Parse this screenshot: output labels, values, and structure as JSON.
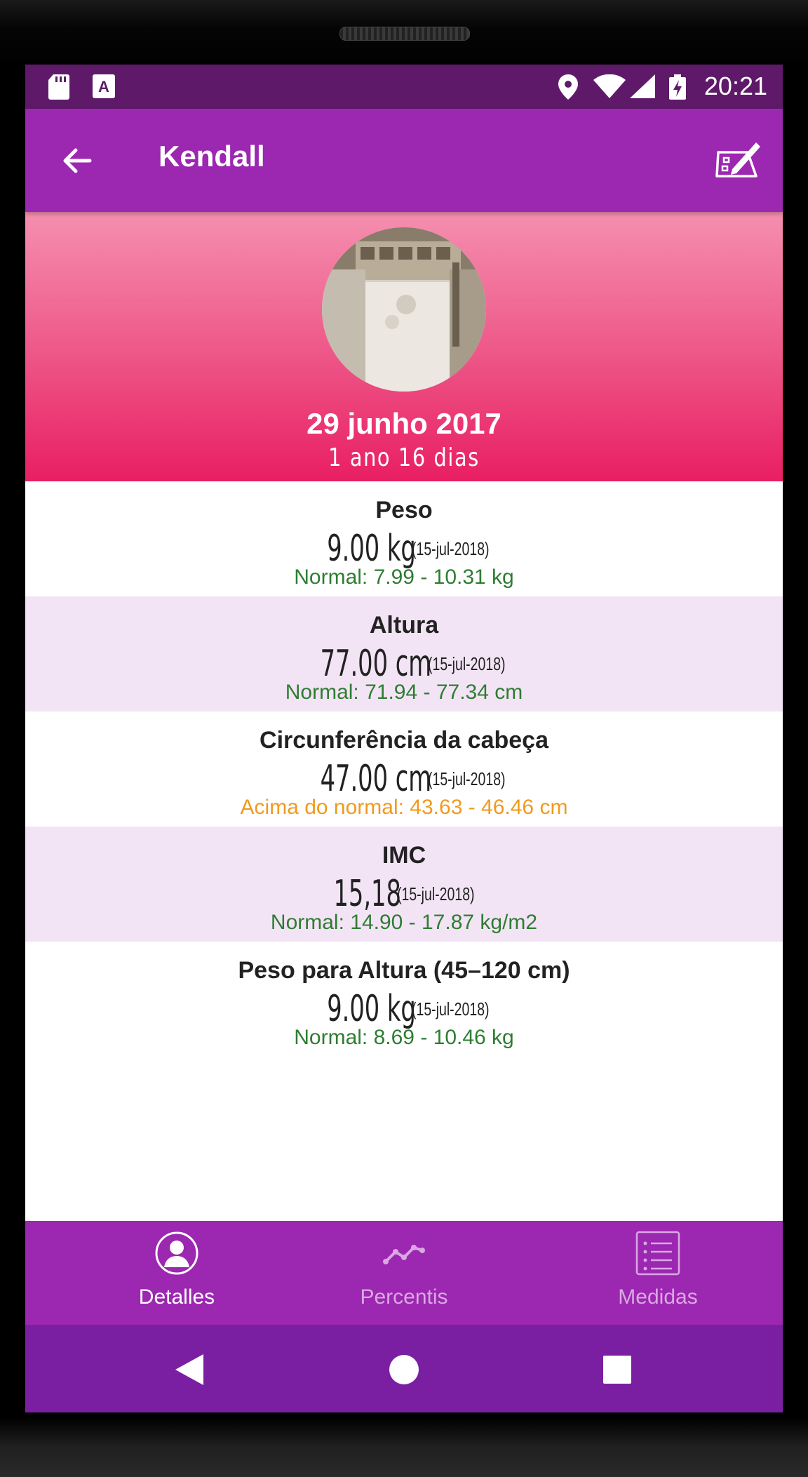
{
  "status_bar": {
    "time": "20:21",
    "left_icons": [
      "sd-card-icon",
      "text-a-icon"
    ],
    "right_icons": [
      "location-icon",
      "wifi-icon",
      "signal-icon",
      "battery-charging-icon"
    ]
  },
  "app_bar": {
    "title": "Kendall",
    "back_icon": "arrow-left-icon",
    "action_icon": "edit-note-icon"
  },
  "header": {
    "birth_date": "29 junho 2017",
    "age": "1 ano 16 dias"
  },
  "measurements": [
    {
      "title": "Peso",
      "value": "9.00 kg",
      "date": "(15-jul-2018)",
      "range": "Normal: 7.99 - 10.31 kg",
      "range_color": "#2e7d32"
    },
    {
      "title": "Altura",
      "value": "77.00 cm",
      "date": "(15-jul-2018)",
      "range": "Normal: 71.94 - 77.34 cm",
      "range_color": "#2e7d32"
    },
    {
      "title": "Circunferência da cabeça",
      "value": "47.00 cm",
      "date": "(15-jul-2018)",
      "range": "Acima do normal:  43.63 - 46.46 cm",
      "range_color": "#f09a1e"
    },
    {
      "title": "IMC",
      "value": "15,18",
      "date": "(15-jul-2018)",
      "range": "Normal: 14.90 - 17.87 kg/m2",
      "range_color": "#2e7d32"
    },
    {
      "title": "Peso para Altura (45–120 cm)",
      "value": "9.00 kg",
      "date": "(15-jul-2018)",
      "range": "Normal: 8.69 - 10.46 kg",
      "range_color": "#2e7d32"
    }
  ],
  "bottom_nav": [
    {
      "label": "Detalles",
      "icon": "person-icon",
      "active": true
    },
    {
      "label": "Percentis",
      "icon": "line-chart-icon",
      "active": false
    },
    {
      "label": "Medidas",
      "icon": "list-icon",
      "active": false
    }
  ],
  "system_nav": [
    "back-triangle-icon",
    "home-circle-icon",
    "recents-square-icon"
  ],
  "colors": {
    "status_bar": "#5e1a68",
    "primary": "#9c27b0",
    "header_gradient_top": "#f58fb0",
    "header_gradient_bottom": "#e91e63",
    "alt_row": "#f3e4f5",
    "normal_range": "#2e7d32",
    "above_range": "#f09a1e",
    "nav_active": "#ffffff",
    "nav_inactive": "#d9a8e3"
  }
}
